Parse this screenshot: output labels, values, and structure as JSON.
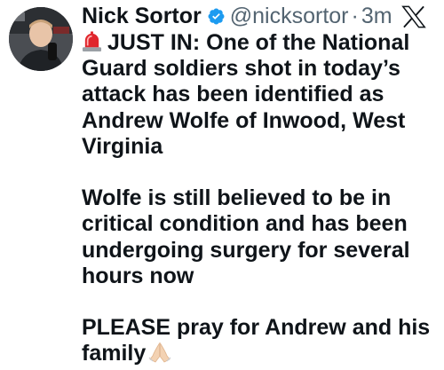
{
  "tweet": {
    "author": {
      "display_name": "Nick Sortor",
      "verified": true,
      "verified_badge": "verified-badge-icon",
      "handle": "@nicksortor",
      "separator": "·",
      "time": "3m"
    },
    "platform_icon": "x-logo-icon",
    "paragraphs": [
      {
        "lead_icon": "police-light-emoji",
        "text": "JUST IN: One of the National Guard soldiers shot in today’s attack has been identified as Andrew Wolfe of Inwood, West Virginia"
      },
      {
        "text": "Wolfe is still believed to be in critical condition and has been undergoing surgery for several hours now"
      },
      {
        "text": "PLEASE pray for Andrew and his family",
        "trail_icon": "folded-hands-emoji"
      }
    ]
  },
  "colors": {
    "text": "#0f1419",
    "secondary": "#536471",
    "verified": "#1d9bf0",
    "siren": "#e0262d"
  }
}
